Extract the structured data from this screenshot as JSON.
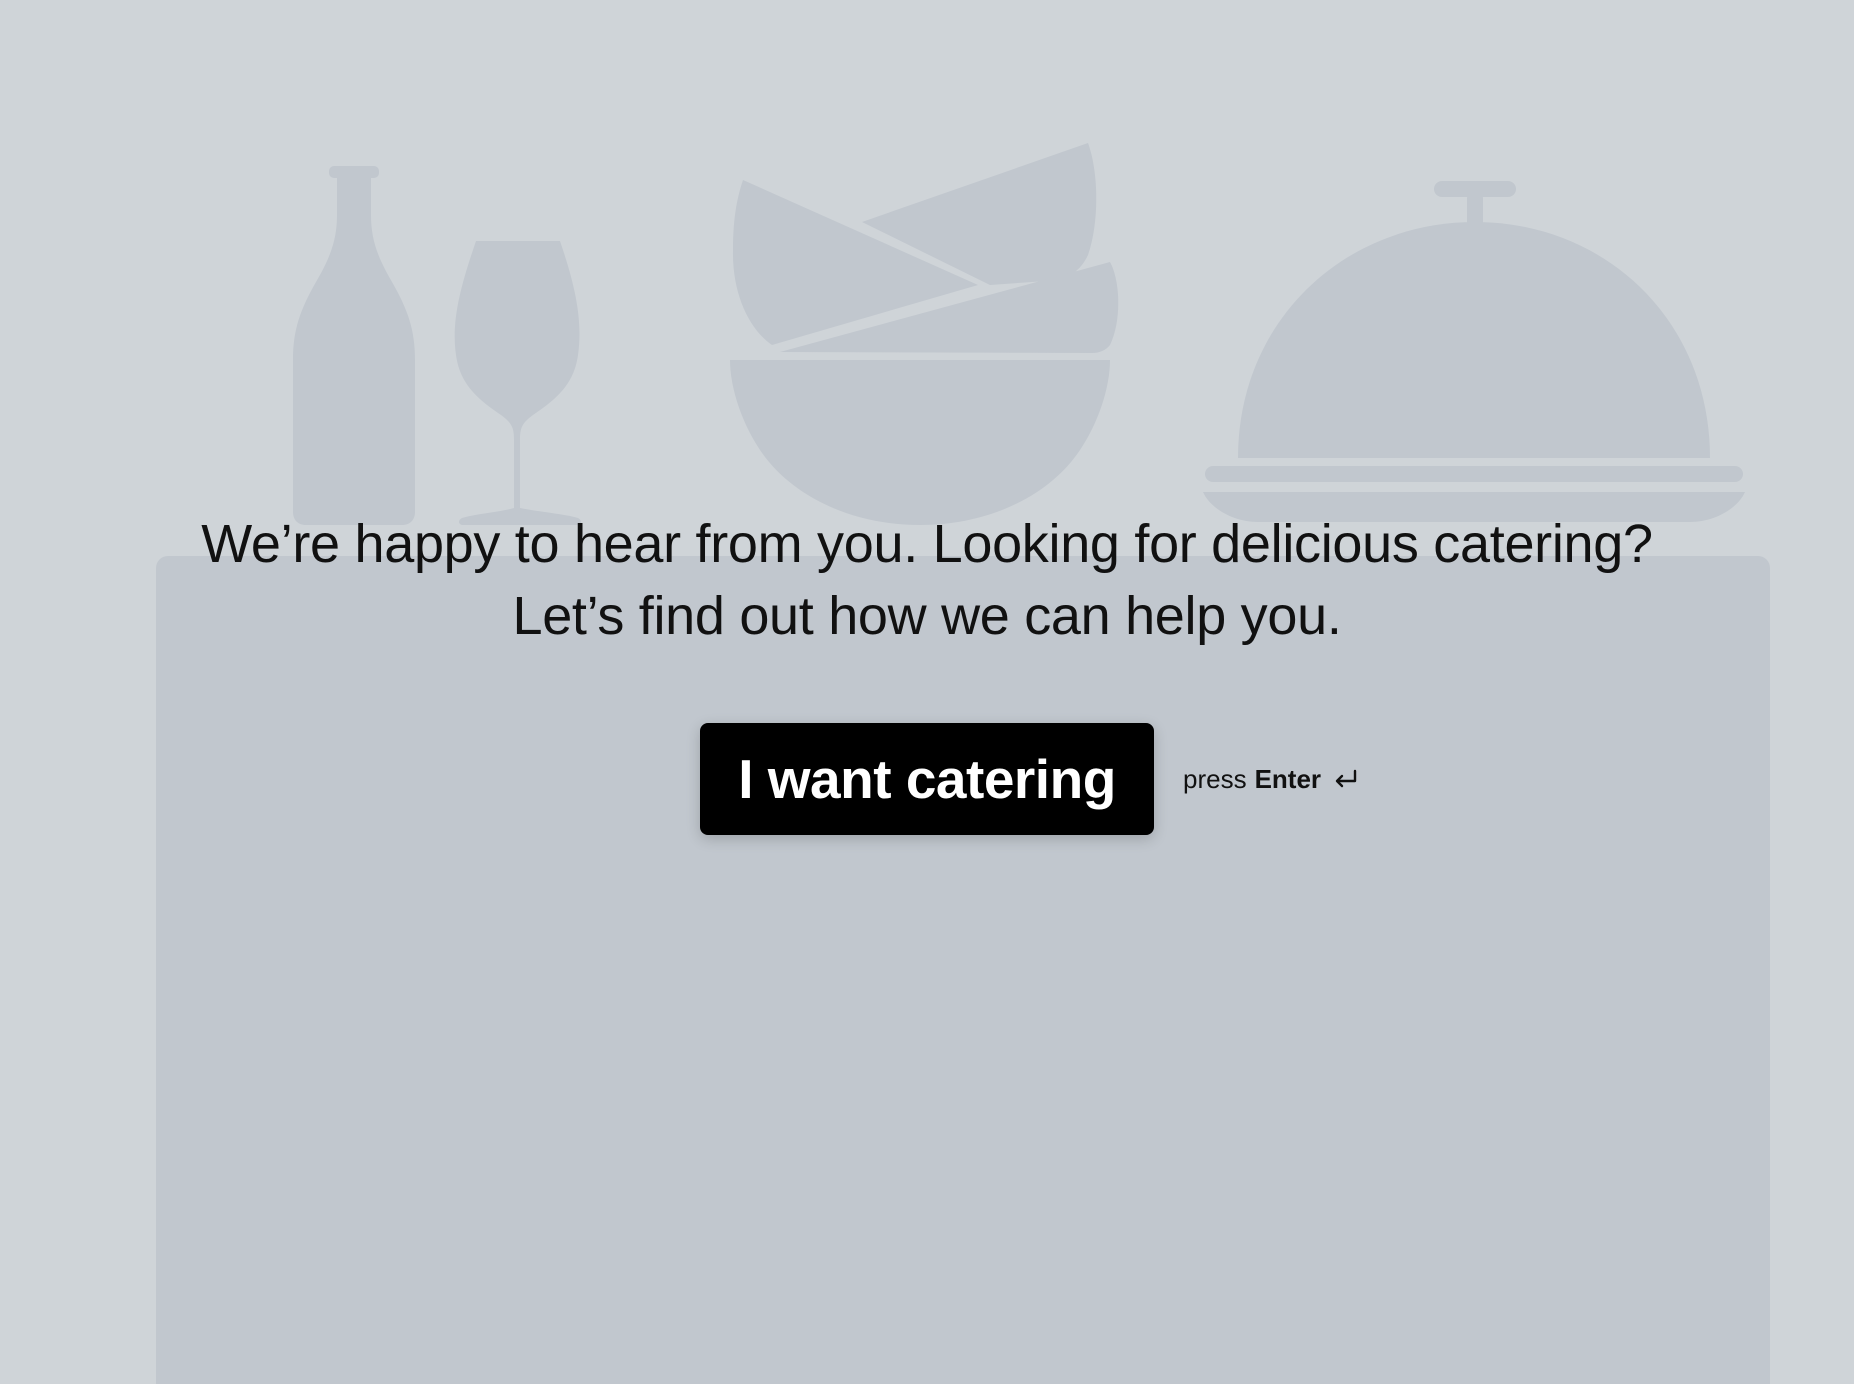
{
  "headline": {
    "line1": "We’re happy to hear from you. Looking for delicious catering?",
    "line2": "Let’s find out how we can help you."
  },
  "cta": {
    "button_label": "I want catering",
    "hint_prefix": "press",
    "hint_key": "Enter",
    "hint_icon": "enter-return-icon"
  },
  "illustration": {
    "icons": [
      "bottle-icon",
      "wine-glass-icon",
      "stacked-bowls-icon",
      "serving-cloche-icon"
    ],
    "fill_color": "#c1c7ce"
  },
  "colors": {
    "background": "#cfd4d8",
    "panel": "#c1c7ce",
    "button": "#000000",
    "button_text": "#ffffff",
    "text": "#111111"
  }
}
